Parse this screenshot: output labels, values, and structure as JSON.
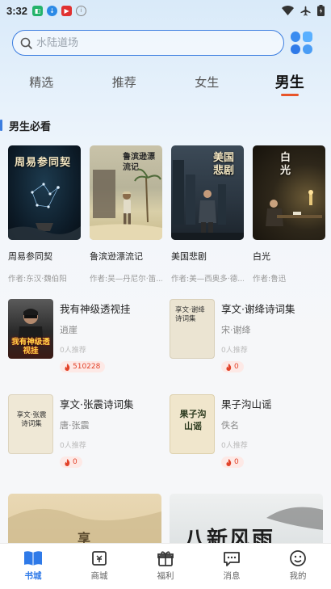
{
  "status_bar": {
    "time": "3:32"
  },
  "search": {
    "placeholder": "水陆道场"
  },
  "tabs": [
    {
      "label": "精选",
      "active": false
    },
    {
      "label": "推荐",
      "active": false
    },
    {
      "label": "女生",
      "active": false
    },
    {
      "label": "男生",
      "active": true
    }
  ],
  "section": {
    "title": "男生必看"
  },
  "featured": [
    {
      "cover_text": "周易参同契",
      "name": "周易参同契",
      "author": "作者:东汉·魏伯阳"
    },
    {
      "cover_text": "鲁滨逊漂流记",
      "name": "鲁滨逊漂流记",
      "author": "作者:吴—丹尼尔·笛..."
    },
    {
      "cover_text": "美国悲剧",
      "name": "美国悲剧",
      "author": "作者:美—西奥多·德..."
    },
    {
      "cover_text": "白光",
      "name": "白光",
      "author": "作者:鲁迅"
    }
  ],
  "books": [
    {
      "cover_text": "我有神级透视挂",
      "title": "我有神级透视挂",
      "author": "逍崖",
      "recs": "0人推荐",
      "heat": "510228"
    },
    {
      "cover_text": "享文·谢绛诗词集",
      "title": "享文·谢绛诗词集",
      "author": "宋·谢绛",
      "recs": "0人推荐",
      "heat": "0"
    },
    {
      "cover_text": "享文·张震诗词集",
      "title": "享文·张震诗词集",
      "author": "唐·张震",
      "recs": "0人推荐",
      "heat": "0"
    },
    {
      "cover_text": "果子沟山谣",
      "title": "果子沟山谣",
      "author": "佚名",
      "recs": "0人推荐",
      "heat": "0"
    }
  ],
  "bottom_covers": [
    {
      "cover_text": "享"
    },
    {
      "cover_text": "八新风雨"
    }
  ],
  "bottom_nav": [
    {
      "label": "书城",
      "icon": "bookstore-icon",
      "active": true
    },
    {
      "label": "商城",
      "icon": "shop-icon",
      "active": false
    },
    {
      "label": "福利",
      "icon": "gift-icon",
      "active": false
    },
    {
      "label": "消息",
      "icon": "message-icon",
      "active": false
    },
    {
      "label": "我的",
      "icon": "profile-icon",
      "active": false
    }
  ],
  "colors": {
    "accent": "#2f7ae8",
    "tab_underline": "#e8552a",
    "heat": "#e2432a"
  }
}
